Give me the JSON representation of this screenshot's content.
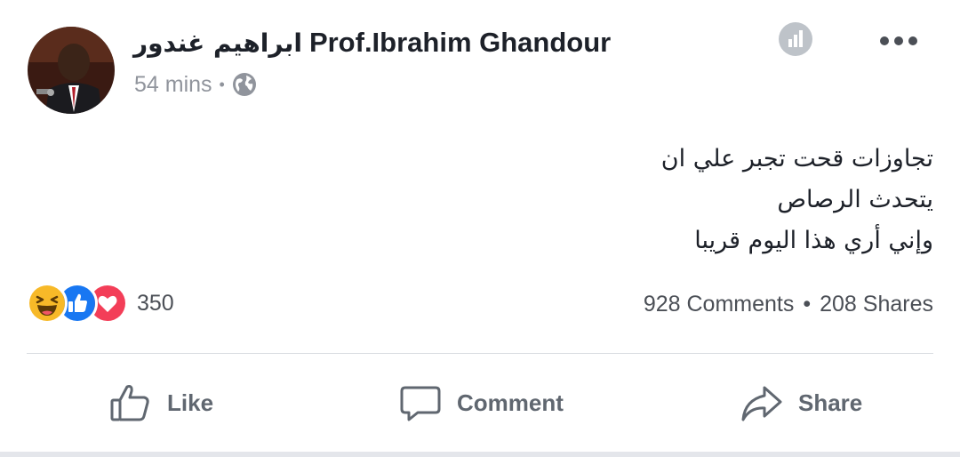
{
  "post": {
    "author_latin": "Prof.Ibrahim Ghandour",
    "author_arabic": "ابراهيم غندور",
    "time": "54 mins",
    "meta_separator": "•",
    "text_lines": [
      "تجاوزات قحت تجبر علي ان",
      "يتحدث الرصاص",
      "وإني أري هذا اليوم قريبا"
    ]
  },
  "reactions": {
    "icons": [
      "haha-icon",
      "like-icon",
      "love-icon"
    ],
    "count": "350"
  },
  "stats": {
    "comments": "928 Comments",
    "separator": "•",
    "shares": "208 Shares"
  },
  "actions": {
    "like_label": "Like",
    "comment_label": "Comment",
    "share_label": "Share"
  },
  "colors": {
    "like_blue": "#1877f2",
    "love_red": "#f33e58",
    "haha_yellow": "#f7b928",
    "secondary_text": "#90949c",
    "action_text": "#606770"
  }
}
